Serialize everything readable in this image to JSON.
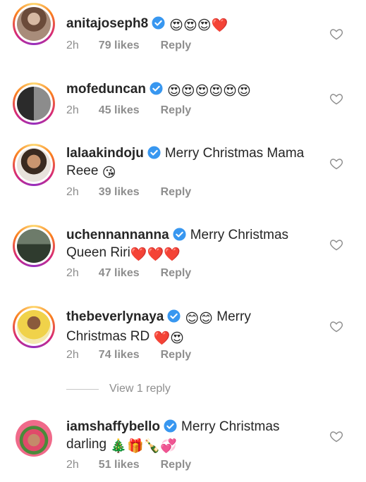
{
  "comments": [
    {
      "username": "anitajoseph8",
      "text": "",
      "emojis": "😍😍😍❤️",
      "time": "2h",
      "likes": "79 likes",
      "reply": "Reply"
    },
    {
      "username": "mofeduncan",
      "text": "",
      "emojis": "😍😍😍😍😍😍",
      "time": "2h",
      "likes": "45 likes",
      "reply": "Reply"
    },
    {
      "username": "lalaakindoju",
      "text": "Merry Christmas Mama Reee",
      "emojis": "😘",
      "time": "2h",
      "likes": "39 likes",
      "reply": "Reply"
    },
    {
      "username": "uchennannanna",
      "text": "Merry Christmas Queen Riri",
      "emojis": "❤️❤️❤️",
      "time": "2h",
      "likes": "47 likes",
      "reply": "Reply"
    },
    {
      "username": "thebeverlynaya",
      "text": "Merry Christmas RD",
      "emojis_before": "😊😊",
      "emojis": "❤️😍",
      "time": "2h",
      "likes": "74 likes",
      "reply": "Reply"
    },
    {
      "username": "iamshaffybello",
      "text": "Merry Christmas darling",
      "emojis": "🎄🎁🍾💞",
      "time": "2h",
      "likes": "51 likes",
      "reply": "Reply"
    }
  ],
  "view_replies": "View 1 reply",
  "icons": {
    "verified": "verified-badge-icon",
    "like": "heart-outline-icon"
  },
  "colors": {
    "verified": "#3897f0",
    "secondary": "#8e8e8e",
    "text": "#262626"
  }
}
